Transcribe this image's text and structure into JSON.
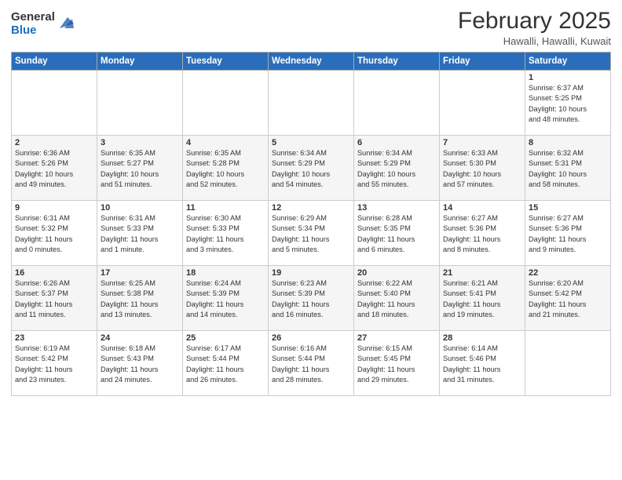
{
  "header": {
    "logo_general": "General",
    "logo_blue": "Blue",
    "month_title": "February 2025",
    "location": "Hawalli, Hawalli, Kuwait"
  },
  "weekdays": [
    "Sunday",
    "Monday",
    "Tuesday",
    "Wednesday",
    "Thursday",
    "Friday",
    "Saturday"
  ],
  "weeks": [
    [
      {
        "day": "",
        "info": ""
      },
      {
        "day": "",
        "info": ""
      },
      {
        "day": "",
        "info": ""
      },
      {
        "day": "",
        "info": ""
      },
      {
        "day": "",
        "info": ""
      },
      {
        "day": "",
        "info": ""
      },
      {
        "day": "1",
        "info": "Sunrise: 6:37 AM\nSunset: 5:25 PM\nDaylight: 10 hours\nand 48 minutes."
      }
    ],
    [
      {
        "day": "2",
        "info": "Sunrise: 6:36 AM\nSunset: 5:26 PM\nDaylight: 10 hours\nand 49 minutes."
      },
      {
        "day": "3",
        "info": "Sunrise: 6:35 AM\nSunset: 5:27 PM\nDaylight: 10 hours\nand 51 minutes."
      },
      {
        "day": "4",
        "info": "Sunrise: 6:35 AM\nSunset: 5:28 PM\nDaylight: 10 hours\nand 52 minutes."
      },
      {
        "day": "5",
        "info": "Sunrise: 6:34 AM\nSunset: 5:29 PM\nDaylight: 10 hours\nand 54 minutes."
      },
      {
        "day": "6",
        "info": "Sunrise: 6:34 AM\nSunset: 5:29 PM\nDaylight: 10 hours\nand 55 minutes."
      },
      {
        "day": "7",
        "info": "Sunrise: 6:33 AM\nSunset: 5:30 PM\nDaylight: 10 hours\nand 57 minutes."
      },
      {
        "day": "8",
        "info": "Sunrise: 6:32 AM\nSunset: 5:31 PM\nDaylight: 10 hours\nand 58 minutes."
      }
    ],
    [
      {
        "day": "9",
        "info": "Sunrise: 6:31 AM\nSunset: 5:32 PM\nDaylight: 11 hours\nand 0 minutes."
      },
      {
        "day": "10",
        "info": "Sunrise: 6:31 AM\nSunset: 5:33 PM\nDaylight: 11 hours\nand 1 minute."
      },
      {
        "day": "11",
        "info": "Sunrise: 6:30 AM\nSunset: 5:33 PM\nDaylight: 11 hours\nand 3 minutes."
      },
      {
        "day": "12",
        "info": "Sunrise: 6:29 AM\nSunset: 5:34 PM\nDaylight: 11 hours\nand 5 minutes."
      },
      {
        "day": "13",
        "info": "Sunrise: 6:28 AM\nSunset: 5:35 PM\nDaylight: 11 hours\nand 6 minutes."
      },
      {
        "day": "14",
        "info": "Sunrise: 6:27 AM\nSunset: 5:36 PM\nDaylight: 11 hours\nand 8 minutes."
      },
      {
        "day": "15",
        "info": "Sunrise: 6:27 AM\nSunset: 5:36 PM\nDaylight: 11 hours\nand 9 minutes."
      }
    ],
    [
      {
        "day": "16",
        "info": "Sunrise: 6:26 AM\nSunset: 5:37 PM\nDaylight: 11 hours\nand 11 minutes."
      },
      {
        "day": "17",
        "info": "Sunrise: 6:25 AM\nSunset: 5:38 PM\nDaylight: 11 hours\nand 13 minutes."
      },
      {
        "day": "18",
        "info": "Sunrise: 6:24 AM\nSunset: 5:39 PM\nDaylight: 11 hours\nand 14 minutes."
      },
      {
        "day": "19",
        "info": "Sunrise: 6:23 AM\nSunset: 5:39 PM\nDaylight: 11 hours\nand 16 minutes."
      },
      {
        "day": "20",
        "info": "Sunrise: 6:22 AM\nSunset: 5:40 PM\nDaylight: 11 hours\nand 18 minutes."
      },
      {
        "day": "21",
        "info": "Sunrise: 6:21 AM\nSunset: 5:41 PM\nDaylight: 11 hours\nand 19 minutes."
      },
      {
        "day": "22",
        "info": "Sunrise: 6:20 AM\nSunset: 5:42 PM\nDaylight: 11 hours\nand 21 minutes."
      }
    ],
    [
      {
        "day": "23",
        "info": "Sunrise: 6:19 AM\nSunset: 5:42 PM\nDaylight: 11 hours\nand 23 minutes."
      },
      {
        "day": "24",
        "info": "Sunrise: 6:18 AM\nSunset: 5:43 PM\nDaylight: 11 hours\nand 24 minutes."
      },
      {
        "day": "25",
        "info": "Sunrise: 6:17 AM\nSunset: 5:44 PM\nDaylight: 11 hours\nand 26 minutes."
      },
      {
        "day": "26",
        "info": "Sunrise: 6:16 AM\nSunset: 5:44 PM\nDaylight: 11 hours\nand 28 minutes."
      },
      {
        "day": "27",
        "info": "Sunrise: 6:15 AM\nSunset: 5:45 PM\nDaylight: 11 hours\nand 29 minutes."
      },
      {
        "day": "28",
        "info": "Sunrise: 6:14 AM\nSunset: 5:46 PM\nDaylight: 11 hours\nand 31 minutes."
      },
      {
        "day": "",
        "info": ""
      }
    ]
  ]
}
